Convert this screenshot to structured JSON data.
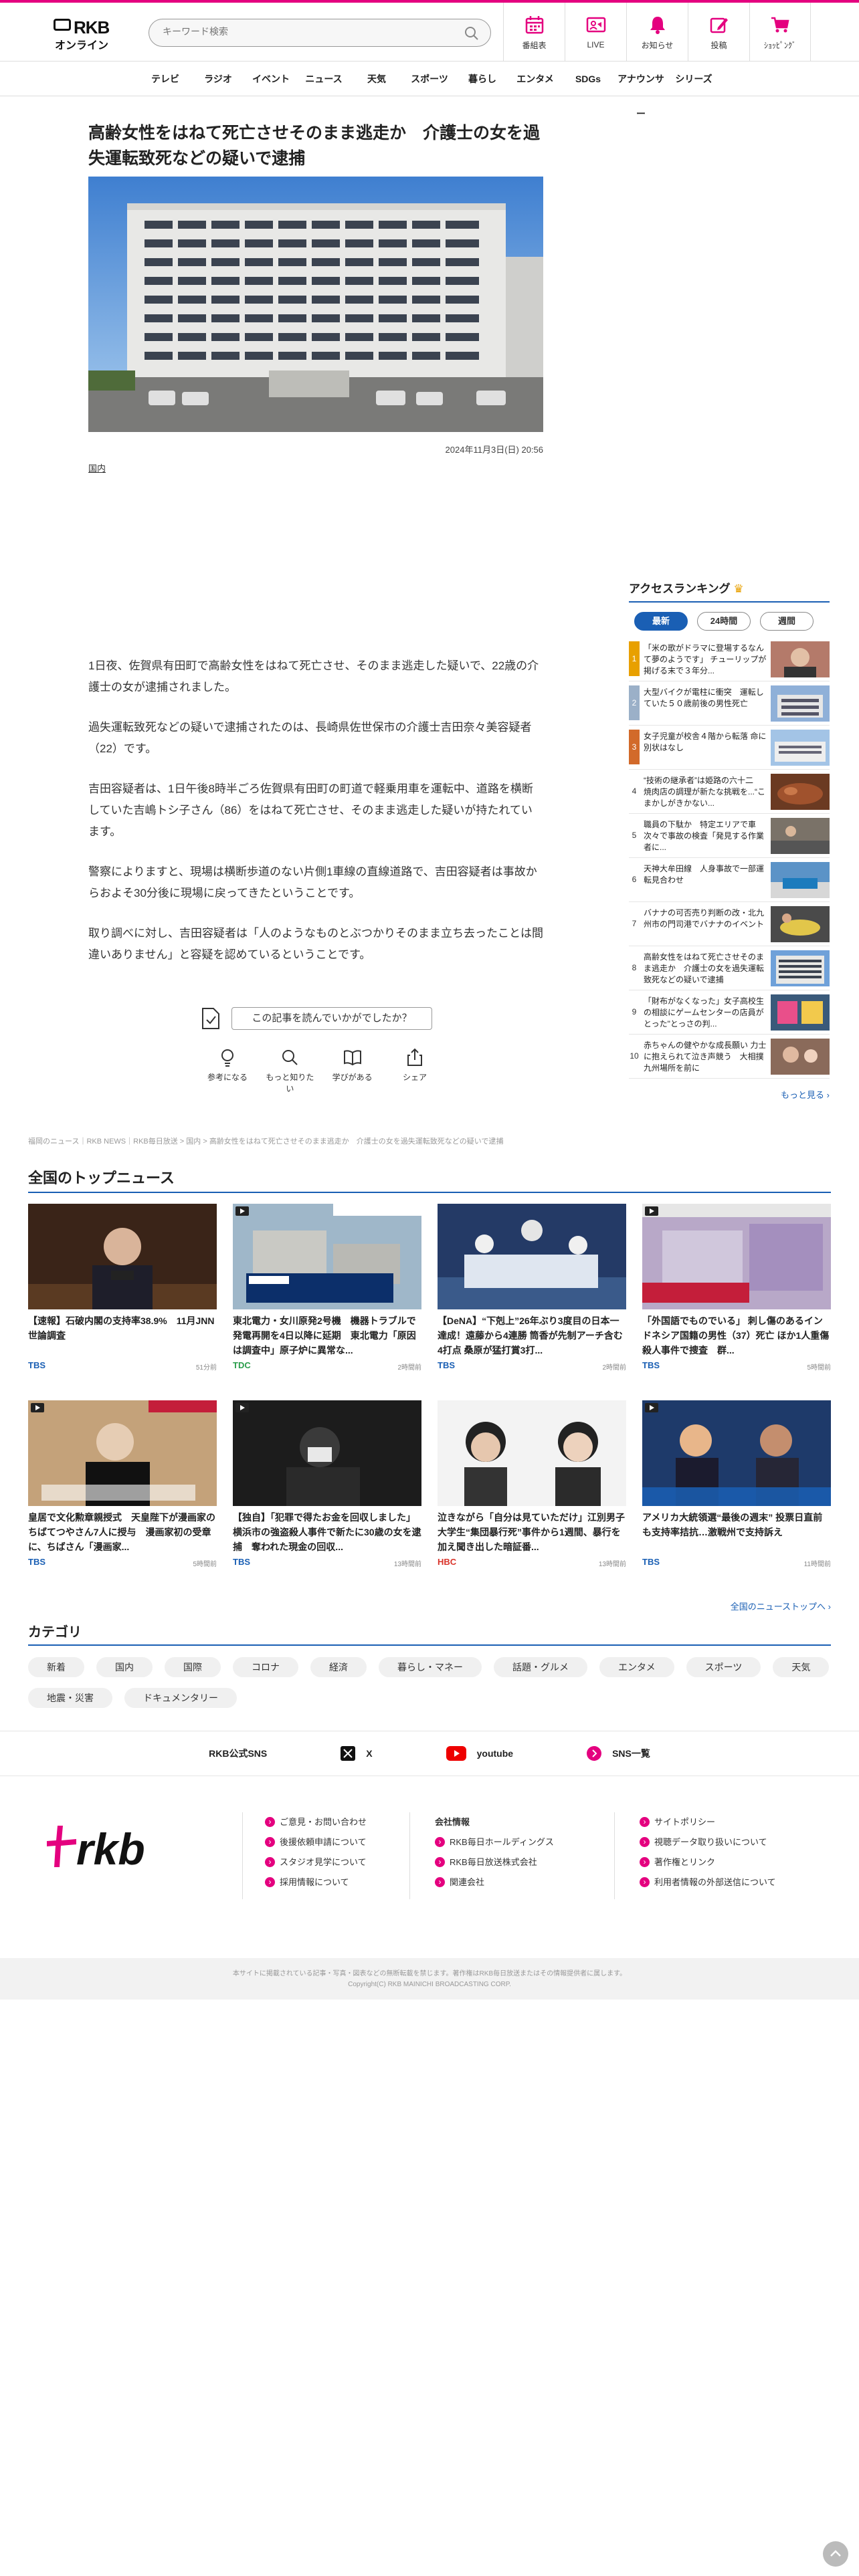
{
  "header": {
    "brand_line1": "RKB",
    "brand_line2": "オンライン",
    "search_placeholder": "キーワード検索",
    "nav": [
      "番組表",
      "LIVE",
      "お知らせ",
      "投稿",
      "ｼｮｯﾋﾟﾝｸﾞ"
    ]
  },
  "categories_nav": [
    "テレビ",
    "ラジオ",
    "イベント",
    "ニュース",
    "天気",
    "スポーツ",
    "暮らし",
    "エンタメ",
    "SDGs",
    "アナウンサー",
    "シリーズ"
  ],
  "article": {
    "headline": "高齢女性をはねて死亡させそのまま逃走か　介護士の女を過失運転致死などの疑いで逮捕",
    "date": "2024年11月3日(日) 20:56",
    "tag": "国内",
    "paragraphs": [
      "1日夜、佐賀県有田町で高齢女性をはねて死亡させ、そのまま逃走した疑いで、22歳の介護士の女が逮捕されました。",
      "過失運転致死などの疑いで逮捕されたのは、長崎県佐世保市の介護士吉田奈々美容疑者（22）です。",
      "吉田容疑者は、1日午後8時半ごろ佐賀県有田町の町道で軽乗用車を運転中、道路を横断していた吉嶋トシ子さん（86）をはねて死亡させ、そのまま逃走した疑いが持たれています。",
      "警察によりますと、現場は横断歩道のない片側1車線の直線道路で、吉田容疑者は事故からおよそ30分後に現場に戻ってきたということです。",
      "取り調べに対し、吉田容疑者は「人のようなものとぶつかりそのまま立ち去ったことは間違いありません」と容疑を認めているということです。"
    ],
    "question": "この記事を読んでいかがでしたか？",
    "reactions": [
      "参考になる",
      "もっと知りたい",
      "学びがある",
      "シェア"
    ]
  },
  "breadcrumb": "福岡のニュース｜RKB NEWS｜RKB毎日放送 > 国内 > 高齢女性をはねて死亡させそのまま逃走か　介護士の女を過失運転致死などの疑いで逮捕",
  "ranking": {
    "title": "アクセスランキング",
    "tabs": [
      "最新",
      "24時間",
      "週間"
    ],
    "items": [
      {
        "no": "1",
        "text": "「米の歌がドラマに登場するなんて夢のようです」 チューリップが掲げる末で３年分..."
      },
      {
        "no": "2",
        "text": "大型バイクが電柱に衝突　運転していた５０歳前後の男性死亡"
      },
      {
        "no": "3",
        "text": "女子児童が校舎４階から転落 命に別状はなし"
      },
      {
        "no": "4",
        "text": "“技術の継承者”は姫路の六十二　焼肉店の調理が新たな挑戦を...“こまかしがきかない..."
      },
      {
        "no": "5",
        "text": "職員の下駄か　特定エリアで車次々で事故の検査「発見する作業者に..."
      },
      {
        "no": "6",
        "text": "天神大牟田線　人身事故で一部運転見合わせ"
      },
      {
        "no": "7",
        "text": "バナナの可否売り判断の改・北九州市の門司港でバナナのイベント"
      },
      {
        "no": "8",
        "text": "高齢女性をはねて死亡させそのまま逃走か　介護士の女を過失運転致死などの疑いで逮捕"
      },
      {
        "no": "9",
        "text": "「財布がなくなった」女子高校生の相談にゲームセンターの店員がとった\"とっさの判..."
      },
      {
        "no": "10",
        "text": "赤ちゃんの健やかな成長願い 力士に抱えられて泣き声競う　大相撲九州場所を前に"
      }
    ],
    "more": "もっと見る ›"
  },
  "top_news": {
    "title": "全国のトップニュース",
    "items": [
      {
        "title": "【速報】石破内閣の支持率38.9%　11月JNN世論調査",
        "source": "TBS",
        "time": "51分前"
      },
      {
        "title": "東北電力・女川原発2号機　機器トラブルで発電再開を4日以降に延期　東北電力「原因は調査中」原子炉に異常な...",
        "source": "TDC",
        "time": "2時間前"
      },
      {
        "title": "【DeNA】“下剋上”26年ぶり3度目の日本一達成！遠藤から4連勝 筒香が先制アーチ含む4打点 桑原が猛打賞3打...",
        "source": "TBS",
        "time": "2時間前"
      },
      {
        "title": "「外国語でものでいる」 刺し傷のあるインドネシア国籍の男性（37）死亡 ほか1人重傷　殺人事件で捜査　群...",
        "source": "TBS",
        "time": "5時間前"
      },
      {
        "title": "皇居で文化勲章親授式　天皇陛下が漫画家のちばてつやさん7人に授与　漫画家初の受章に、ちばさん「漫画家...",
        "source": "TBS",
        "time": "5時間前"
      },
      {
        "title": "【独自】「犯罪で得たお金を回収しました」横浜市の強盗殺人事件で新たに30歳の女を逮捕　奪われた現金の回収...",
        "source": "TBS",
        "time": "13時間前"
      },
      {
        "title": "泣きながら「自分は見ていただけ」江別男子大学生“集団暴行死”事件から1週間、暴行を加え聞き出した暗証番...",
        "source": "HBC",
        "time": "13時間前"
      },
      {
        "title": "アメリカ大統領選“最後の週末” 投票日直前も支持率拮抗…激戦州で支持訴え",
        "source": "TBS",
        "time": "11時間前"
      }
    ],
    "more": "全国のニューストップへ ›"
  },
  "category": {
    "title": "カテゴリ",
    "chips": [
      "新着",
      "国内",
      "国際",
      "コロナ",
      "経済",
      "暮らし・マネー",
      "話題・グルメ",
      "エンタメ",
      "スポーツ",
      "天気",
      "地震・災害",
      "ドキュメンタリー"
    ]
  },
  "sns": {
    "label": "RKB公式SNS",
    "items": [
      "X",
      "youtube",
      "SNS一覧"
    ]
  },
  "footer": {
    "col1": [
      "ご意見・お問い合わせ",
      "後援依頼申請について",
      "スタジオ見学について",
      "採用情報について"
    ],
    "col2_head": "会社情報",
    "col2": [
      "RKB毎日ホールディングス",
      "RKB毎日放送株式会社",
      "関連会社"
    ],
    "col3": [
      "サイトポリシー",
      "視聴データ取り扱いについて",
      "著作権とリンク",
      "利用者情報の外部送信について"
    ],
    "notice": "本サイトに掲載されている記事・写真・図表などの無断転載を禁じます。著作権はRKB毎日放送またはその情報提供者に属します。",
    "copyright": "Copyright(C) RKB MAINICHI BROADCASTING CORP."
  },
  "colors": {
    "accent": "#e4007f",
    "link": "#1a5fb4",
    "TBS": "#1a5fb4",
    "TDC": "#2a9d4b",
    "HBC": "#d9332a"
  }
}
